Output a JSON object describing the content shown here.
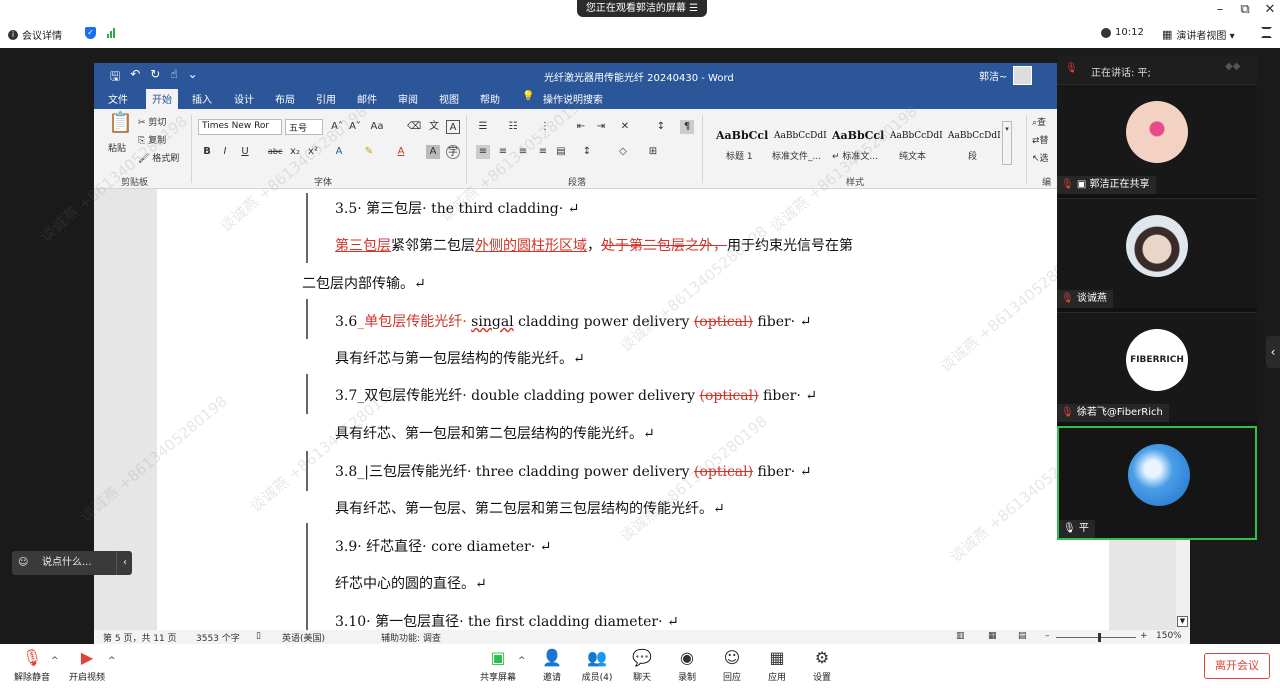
{
  "top": {
    "banner": "您正在观看郭洁的屏幕 ☰",
    "meeting_details": "会议详情",
    "clock": "10:12",
    "speaker_view": "演讲者视图 ▾"
  },
  "word": {
    "doc_title": "光纤激光器用传能光纤 20240430  -  Word",
    "user": "郭洁~",
    "tabs": [
      "文件",
      "开始",
      "插入",
      "设计",
      "布局",
      "引用",
      "邮件",
      "审阅",
      "视图",
      "帮助",
      "操作说明搜索"
    ],
    "ribbon": {
      "cut": "剪切",
      "copy": "复制",
      "format_painter": "格式刷",
      "paste": "粘贴",
      "clipboard_group": "剪贴板",
      "font_name": "Times New Ror",
      "font_size": "五号",
      "font_group": "字体",
      "paragraph_group": "段落",
      "styles_group": "样式",
      "style_names": [
        "标题 1",
        "标准文件_...",
        "↵ 标准文...",
        "纯文本",
        "段"
      ],
      "style_previews": [
        "AaBbCcl",
        "AaBbCcDdI",
        "AaBbCcl",
        "AaBbCcDdI",
        "AaBbCcDdI"
      ],
      "find": "查",
      "replace": "替",
      "select": "选",
      "edit_group": "编"
    },
    "doc": {
      "l1": "3.5· 第三包层· the third cladding· ↵",
      "l2_a": "第三包层",
      "l2_b": "紧邻第二包层",
      "l2_c": "外侧的圆柱形区域",
      "l2_d": "，",
      "l2_e": "处于第二包层之外，",
      "l2_f": "用于约束光信号在第",
      "l3": "二包层内部传输。↵",
      "l4_a": "3.6",
      "l4_b": "_单包层传能光纤· ",
      "l4_c": "singal",
      "l4_d": " cladding power delivery ",
      "l4_e": "(optical)",
      "l4_f": " fiber· ↵",
      "l5": "具有纤芯与第一包层结构的传能光纤。↵",
      "l6_a": "3.7",
      "l6_b": "_双包层传能光纤· double cladding power delivery ",
      "l6_c": "(optical)",
      "l6_d": " fiber· ↵",
      "l7": "具有纤芯、第一包层和第二包层结构的传能光纤。↵",
      "l8_a": "3.8",
      "l8_b": "_|三包层传能光纤· three cladding power delivery ",
      "l8_c": "(optical)",
      "l8_d": " fiber· ↵",
      "l9": "具有纤芯、第一包层、第二包层和第三包层结构的传能光纤。↵",
      "l10": "3.9· 纤芯直径· core diameter· ↵",
      "l11": "纤芯中心的圆的直径。↵",
      "l12": "3.10· 第一包层直径· the first cladding diameter· ↵"
    },
    "status": {
      "page": "第 5 页，共 11 页",
      "words": "3553 个字",
      "lang": "英语(美国)",
      "accessibility": "辅助功能: 调查",
      "zoom": "150%"
    }
  },
  "panel": {
    "speaking": "正在讲话: 平;",
    "participants": [
      {
        "name": "郭洁正在共享"
      },
      {
        "name": "谈诚燕"
      },
      {
        "name": "徐若飞@FiberRich"
      },
      {
        "name": "平"
      }
    ],
    "logo_text": "FIBERRICH"
  },
  "chat_placeholder": "说点什么...",
  "toolbar": {
    "unmute": "解除静音",
    "start_video": "开启视频",
    "share": "共享屏幕",
    "invite": "邀请",
    "members": "成员(4)",
    "chat": "聊天",
    "record": "录制",
    "reaction": "回应",
    "apps": "应用",
    "settings": "设置",
    "leave": "离开会议"
  },
  "watermark": "谈诚燕 +8613405280198",
  "colors": {
    "word_blue": "#2b579a",
    "revision_red": "#d0352b",
    "active_tile": "#2fbf4f",
    "leave_red": "#e0433a"
  }
}
